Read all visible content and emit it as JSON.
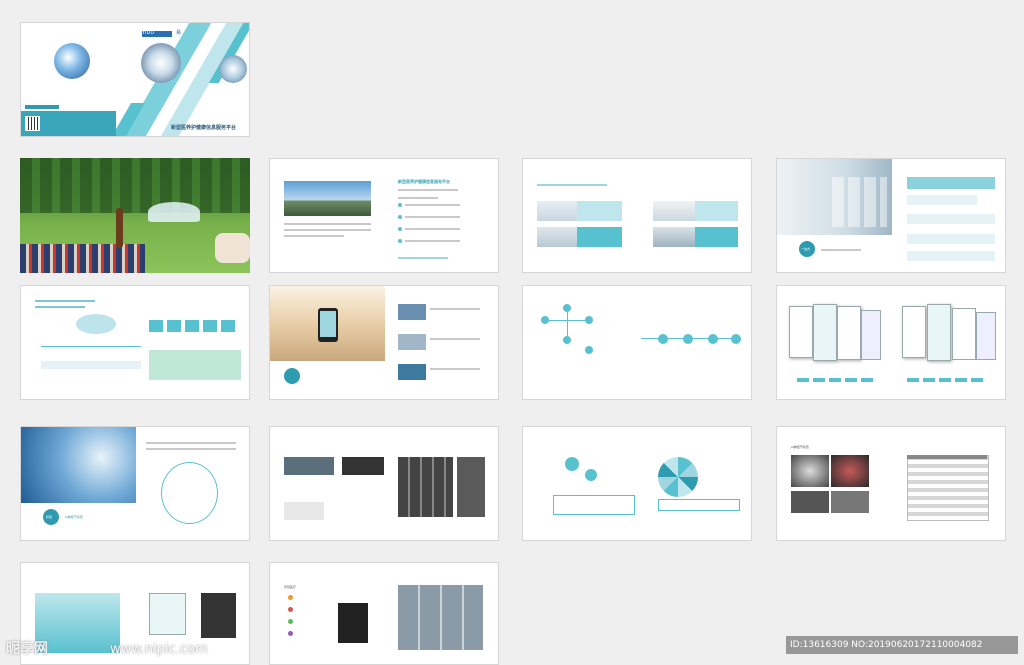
{
  "cover": {
    "brand_text": "YIDU",
    "partner_text": "易",
    "title": "新型医养护健康信息服务平台"
  },
  "pages": {
    "p3": {
      "head": "新型医养护健康信息服务平台"
    },
    "p4": {
      "badge": "一站式"
    },
    "p10": {
      "badge": "智慧",
      "caption": "AI肺结节筛查"
    },
    "p13": {
      "caption": "AI肺结节筛查"
    },
    "p18": {
      "caption": "智慧医疗"
    }
  },
  "watermark": {
    "logo": "昵享网",
    "url": "www.nipic.com",
    "id_text": "ID:13616309 NO:20190620172110004082"
  },
  "colors": {
    "accent": "#58c1cf",
    "dark": "#2f9bb1"
  }
}
